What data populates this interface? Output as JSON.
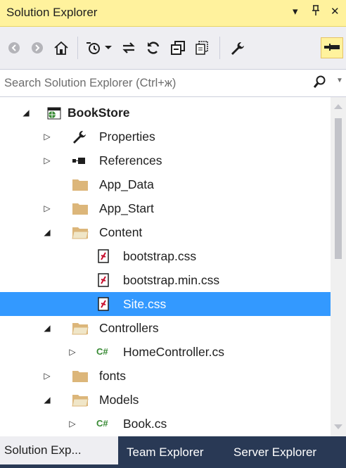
{
  "panel": {
    "title": "Solution Explorer",
    "dropdown_glyph": "▾",
    "pin_glyph": "ꟸ",
    "close_glyph": "✕"
  },
  "toolbar": {
    "buttons": [
      "back-icon",
      "forward-icon",
      "home-icon",
      "history-icon",
      "dropdown-arrow",
      "sync-icon",
      "refresh-icon",
      "collapse-all-icon",
      "show-all-files-icon",
      "properties-wrench-icon",
      "preview-pin-icon"
    ]
  },
  "search": {
    "placeholder": "Search Solution Explorer (Ctrl+ж)"
  },
  "tree": {
    "items": [
      {
        "label": "BookStore",
        "icon": "web-project-icon",
        "expander": "◢",
        "bold": true
      },
      {
        "label": "Properties",
        "icon": "wrench-icon",
        "expander": "▷"
      },
      {
        "label": "References",
        "icon": "references-icon",
        "expander": "▷"
      },
      {
        "label": "App_Data",
        "icon": "folder-icon",
        "expander": ""
      },
      {
        "label": "App_Start",
        "icon": "folder-icon",
        "expander": "▷"
      },
      {
        "label": "Content",
        "icon": "open-folder-icon",
        "expander": "◢"
      },
      {
        "label": "bootstrap.css",
        "icon": "css-file-icon",
        "expander": ""
      },
      {
        "label": "bootstrap.min.css",
        "icon": "css-file-icon",
        "expander": ""
      },
      {
        "label": "Site.css",
        "icon": "css-file-icon",
        "expander": "",
        "selected": true
      },
      {
        "label": "Controllers",
        "icon": "open-folder-icon",
        "expander": "◢"
      },
      {
        "label": "HomeController.cs",
        "icon": "csharp-file-icon",
        "expander": "▷",
        "cs_glyph": "C#"
      },
      {
        "label": "fonts",
        "icon": "folder-icon",
        "expander": "▷"
      },
      {
        "label": "Models",
        "icon": "open-folder-icon",
        "expander": "◢"
      },
      {
        "label": "Book.cs",
        "icon": "csharp-file-icon",
        "expander": "▷",
        "cs_glyph": "C#"
      }
    ]
  },
  "tabs": [
    {
      "label": "Solution Exp...",
      "active": true
    },
    {
      "label": "Team Explorer"
    },
    {
      "label": "Server Explorer"
    }
  ],
  "colors": {
    "title_bg": "#FFF29D",
    "selection": "#3399FF",
    "folder": "#DCB67A",
    "tab_strip": "#293955"
  }
}
